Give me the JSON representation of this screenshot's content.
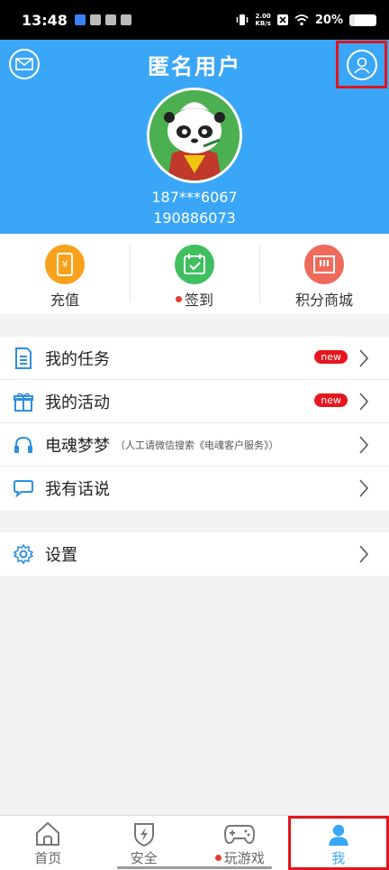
{
  "status": {
    "time": "13:48",
    "netspeed_top": "2.00",
    "netspeed_unit": "KB/s",
    "battery": "20%"
  },
  "header": {
    "title": "匿名用户",
    "phone": "187***6067",
    "uid": "190886073"
  },
  "quick_actions": [
    {
      "label": "充值",
      "color": "#f7a21a",
      "icon": "phone-yen-icon",
      "dot": false
    },
    {
      "label": "签到",
      "color": "#3fbf5f",
      "icon": "calendar-check-icon",
      "dot": true
    },
    {
      "label": "积分商城",
      "color": "#ef6a5a",
      "icon": "shop-icon",
      "dot": false
    }
  ],
  "menu1": [
    {
      "label": "我的任务",
      "badge": "new",
      "icon": "document-icon"
    },
    {
      "label": "我的活动",
      "badge": "new",
      "icon": "gift-icon"
    },
    {
      "label": "电魂梦梦",
      "note": "（人工请微信搜索《电魂客户服务》）",
      "icon": "headset-icon"
    },
    {
      "label": "我有话说",
      "icon": "chat-bubble-icon"
    }
  ],
  "menu2": [
    {
      "label": "设置",
      "icon": "gear-icon"
    }
  ],
  "tabs": [
    {
      "label": "首页",
      "icon": "home-icon"
    },
    {
      "label": "安全",
      "icon": "shield-bolt-icon"
    },
    {
      "label": "玩游戏",
      "icon": "gamepad-icon",
      "dot": true
    },
    {
      "label": "我",
      "icon": "person-icon",
      "active": true
    }
  ],
  "colors": {
    "accent": "#3aa6f7",
    "badge": "#e5161f",
    "highlight": "#e0161c"
  }
}
